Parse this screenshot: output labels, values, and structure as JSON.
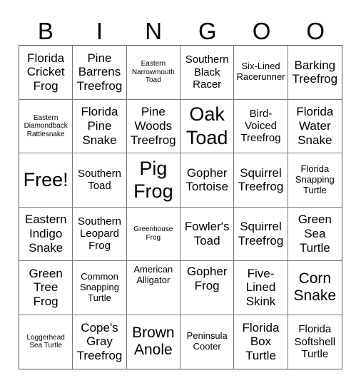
{
  "header": [
    "B",
    "I",
    "N",
    "G",
    "O",
    "O"
  ],
  "cells": [
    "Florida Cricket Frog",
    "Pine Barrens Treefrog",
    "Eastern Narrowmouth Toad",
    "Southern Black Racer",
    "Six-Lined Racerunner",
    "Barking Treefrog",
    "Eastern Diamondback Rattlesnake",
    "Florida Pine Snake",
    "Pine Woods Treefrog",
    "Oak Toad",
    "Bird-Voiced Treefrog",
    "Florida Water Snake",
    "Free!",
    "Southern Toad",
    "Pig Frog",
    "Gopher Tortoise",
    "Squirrel Treefrog",
    "Florida Snapping Turtle",
    "Eastern Indigo Snake",
    "Southern Leopard Frog",
    "Greenhouse Frog",
    "Fowler's Toad",
    "Squirrel Treefrog",
    "Green Sea Turtle",
    "Green Tree Frog",
    "Common Snapping Turtle",
    "American Alligator",
    "Gopher Frog",
    "Five-Lined Skink",
    "Corn Snake",
    "Loggerhead Sea Turtle",
    "Cope's Gray Treefrog",
    "Brown Anole",
    "Peninsula Cooter",
    "Florida Box Turtle",
    "Florida Softshell Turtle"
  ]
}
